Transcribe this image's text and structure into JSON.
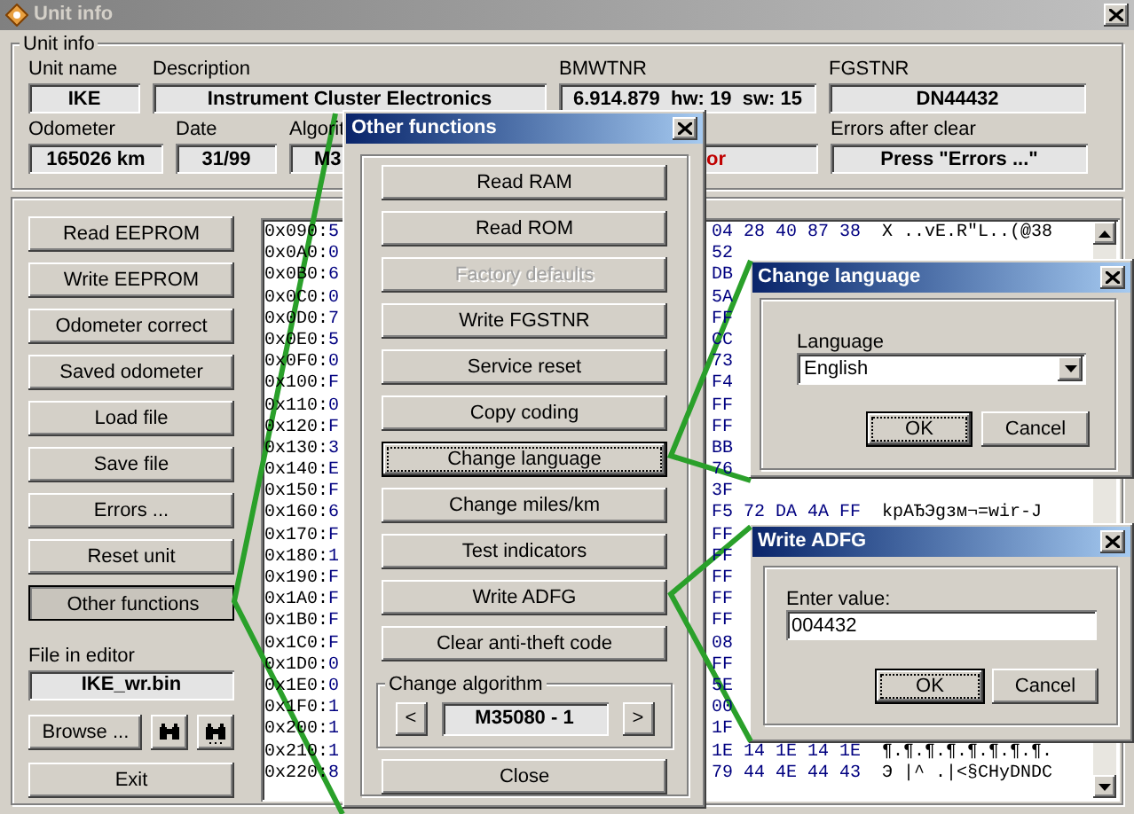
{
  "window": {
    "title": "Unit info",
    "active": false
  },
  "unit_info": {
    "title": "Unit info",
    "upper_fields": [
      {
        "label": "Unit name",
        "value": "IKE",
        "alert": false
      },
      {
        "label": "Description",
        "value": "Instrument Cluster Electronics",
        "alert": false
      },
      {
        "label": "BMWTNR",
        "value": "6.914.879  hw: 19  sw: 15",
        "alert": false
      },
      {
        "label": "FGSTNR",
        "value": "DN44432",
        "alert": false
      }
    ],
    "lower_fields": [
      {
        "label": "Odometer",
        "value": "165026 km",
        "alert": false
      },
      {
        "label": "Date",
        "value": "31/99",
        "alert": false
      },
      {
        "label": "Algorit",
        "value": "M3",
        "alert": false
      },
      {
        "value": "or",
        "alert": true
      },
      {
        "label": "Errors after clear",
        "value": "Press \"Errors ...\"",
        "alert": false
      }
    ]
  },
  "actions": [
    {
      "label": "Read EEPROM",
      "pressed": false
    },
    {
      "label": "Write EEPROM",
      "pressed": false
    },
    {
      "label": "Odometer correct",
      "pressed": false
    },
    {
      "label": "Saved odometer",
      "pressed": false
    },
    {
      "label": "Load file",
      "pressed": false
    },
    {
      "label": "Save file",
      "pressed": false
    },
    {
      "label": "Errors ...",
      "pressed": false
    },
    {
      "label": "Reset unit",
      "pressed": false
    },
    {
      "label": "Other functions",
      "pressed": true
    }
  ],
  "file_in_editor": {
    "label": "File in editor",
    "value": "IKE_wr.bin"
  },
  "browse_button": "Browse ...",
  "exit_button": "Exit",
  "hex_editor": {
    "rows": [
      {
        "address": "0x090:",
        "byte": "5",
        "bytes": "04 28 40 87 38",
        "ascii": "X ..vE.R\"L..(@38"
      },
      {
        "address": "0x0A0:",
        "byte": "0",
        "bytes": "52"
      },
      {
        "address": "0x0B0:",
        "byte": "6",
        "bytes": "DB"
      },
      {
        "address": "0x0C0:",
        "byte": "0",
        "bytes": "5A"
      },
      {
        "address": "0x0D0:",
        "byte": "7",
        "bytes": "FF"
      },
      {
        "address": "0x0E0:",
        "byte": "5",
        "bytes": "CC"
      },
      {
        "address": "0x0F0:",
        "byte": "0",
        "bytes": "73"
      },
      {
        "address": "0x100:",
        "byte": "F",
        "bytes": "F4"
      },
      {
        "address": "0x110:",
        "byte": "0",
        "bytes": "FF"
      },
      {
        "address": "0x120:",
        "byte": "F",
        "bytes": "FF"
      },
      {
        "address": "0x130:",
        "byte": "3",
        "bytes": "BB"
      },
      {
        "address": "0x140:",
        "byte": "E",
        "bytes": "76"
      },
      {
        "address": "0x150:",
        "byte": "F",
        "bytes": "3F"
      },
      {
        "address": "0x160:",
        "byte": "6",
        "bytes": "F5 72 DA 4A FF",
        "ascii": "kpAЂЭgзм¬=wir-J"
      },
      {
        "address": "0x170:",
        "byte": "F",
        "bytes": "FF"
      },
      {
        "address": "0x180:",
        "byte": "1",
        "bytes": "FF"
      },
      {
        "address": "0x190:",
        "byte": "F",
        "bytes": "FF"
      },
      {
        "address": "0x1A0:",
        "byte": "F",
        "bytes": "FF"
      },
      {
        "address": "0x1B0:",
        "byte": "F",
        "bytes": "FF"
      },
      {
        "address": "0x1C0:",
        "byte": "F",
        "bytes": "08"
      },
      {
        "address": "0x1D0:",
        "byte": "0",
        "bytes": "FF"
      },
      {
        "address": "0x1E0:",
        "byte": "0",
        "bytes": "5E"
      },
      {
        "address": "0x1F0:",
        "byte": "1",
        "bytes": "00"
      },
      {
        "address": "0x200:",
        "byte": "1",
        "bytes": "1F"
      },
      {
        "address": "0x210:",
        "byte": "1",
        "bytes": "1E 14 1E 14 1E",
        "ascii": "¶.¶.¶.¶.¶.¶.¶.¶."
      },
      {
        "address": "0x220:",
        "byte": "8",
        "bytes": "79 44 4E 44 43",
        "ascii": "Э |^ .|<§CHyDNDC"
      }
    ]
  },
  "other_functions": {
    "title": "Other functions",
    "active": true,
    "buttons": [
      {
        "label": "Read RAM",
        "disabled": false,
        "focused": false
      },
      {
        "label": "Read ROM",
        "disabled": false,
        "focused": false
      },
      {
        "label": "Factory defaults",
        "disabled": true,
        "focused": false
      },
      {
        "label": "Write FGSTNR",
        "disabled": false,
        "focused": false
      },
      {
        "label": "Service reset",
        "disabled": false,
        "focused": false
      },
      {
        "label": "Copy coding",
        "disabled": false,
        "focused": false
      },
      {
        "label": "Change language",
        "disabled": false,
        "focused": true
      },
      {
        "label": "Change miles/km",
        "disabled": false,
        "focused": false
      },
      {
        "label": "Test indicators",
        "disabled": false,
        "focused": false
      },
      {
        "label": "Write ADFG",
        "disabled": false,
        "focused": false
      },
      {
        "label": "Clear anti-theft code",
        "disabled": false,
        "focused": false
      }
    ],
    "algorithm": {
      "title": "Change algorithm",
      "prev": "<",
      "value": "M35080 - 1",
      "next": ">"
    },
    "close": "Close"
  },
  "change_language": {
    "title": "Change language",
    "active": true,
    "label": "Language",
    "value": "English",
    "ok": {
      "label": "OK",
      "focused": true
    },
    "cancel": {
      "label": "Cancel",
      "focused": false
    }
  },
  "write_adfg": {
    "title": "Write ADFG",
    "active": true,
    "label": "Enter value:",
    "value": "004432",
    "ok": {
      "label": "OK",
      "focused": true
    },
    "cancel": {
      "label": "Cancel",
      "focused": false
    }
  }
}
